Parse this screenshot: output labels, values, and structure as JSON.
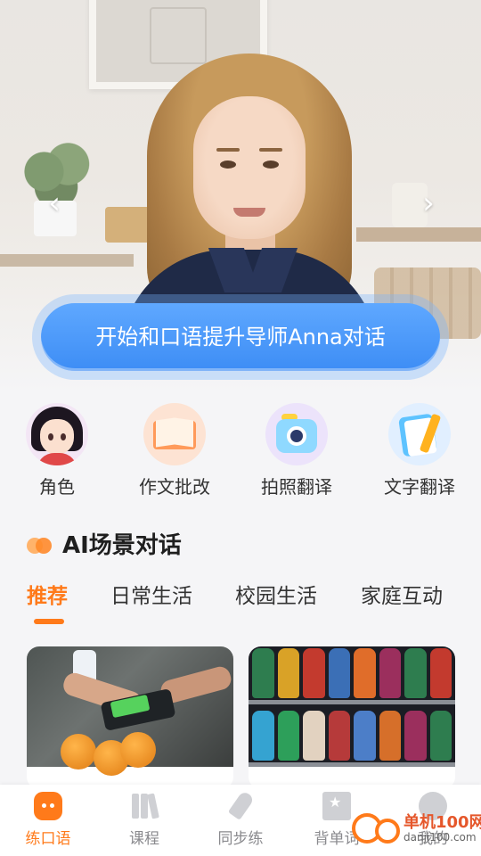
{
  "hero": {
    "cta_label": "开始和口语提升导师Anna对话",
    "prev_arrow": "‹",
    "next_arrow": "›"
  },
  "tools": [
    {
      "label": "角色",
      "icon": "character-icon"
    },
    {
      "label": "作文批改",
      "icon": "book-icon"
    },
    {
      "label": "拍照翻译",
      "icon": "camera-icon"
    },
    {
      "label": "文字翻译",
      "icon": "notepad-pen-icon"
    }
  ],
  "section": {
    "title": "AI场景对话",
    "tabs": [
      {
        "label": "推荐",
        "active": true
      },
      {
        "label": "日常生活",
        "active": false
      },
      {
        "label": "校园生活",
        "active": false
      },
      {
        "label": "家庭互动",
        "active": false
      }
    ]
  },
  "cards": [
    {
      "scene": "checkout-payment",
      "icon": "scene-image"
    },
    {
      "scene": "drink-shelf",
      "icon": "scene-image"
    }
  ],
  "bottom_nav": [
    {
      "label": "练口语",
      "icon": "chat-bubble-icon",
      "active": true
    },
    {
      "label": "课程",
      "icon": "books-icon",
      "active": false
    },
    {
      "label": "同步练",
      "icon": "rocket-icon",
      "active": false
    },
    {
      "label": "背单词",
      "icon": "word-book-icon",
      "active": false
    },
    {
      "label": "我的",
      "icon": "profile-icon",
      "active": false
    }
  ],
  "watermark": {
    "line1": "单机100网",
    "line2": "danji100.com"
  },
  "colors": {
    "accent": "#ff7a1a",
    "cta": "#3d8df5",
    "background": "#f5f5f7"
  }
}
